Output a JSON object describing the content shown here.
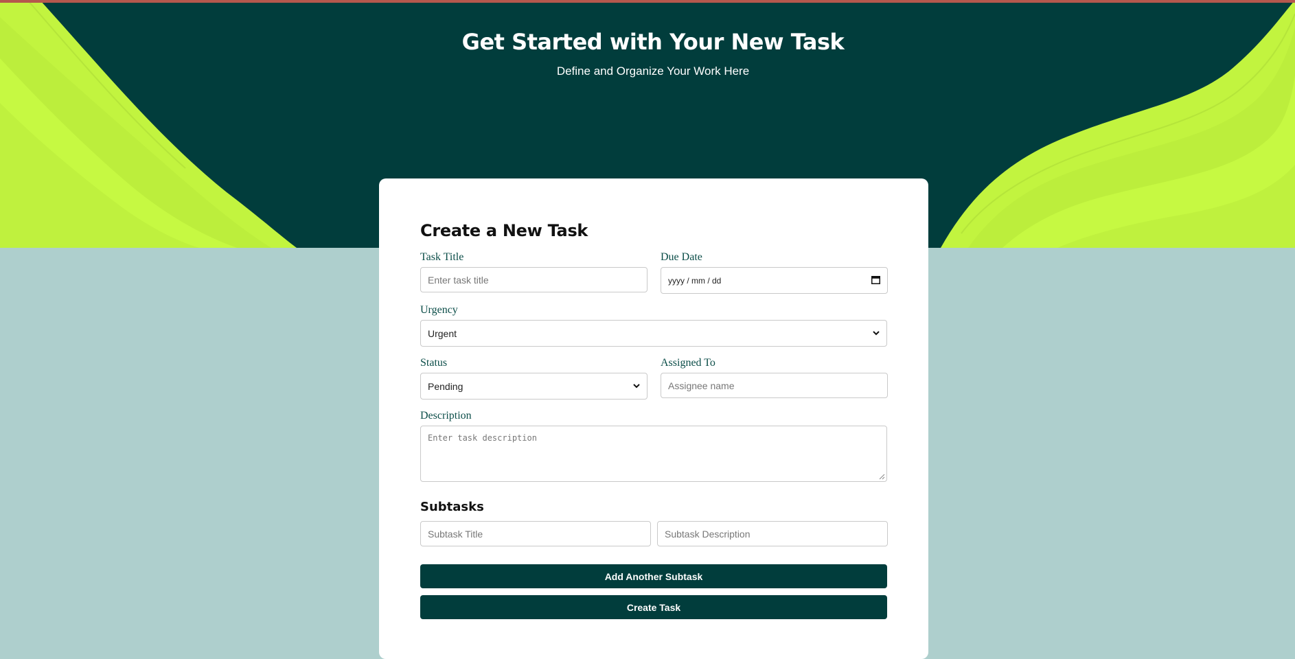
{
  "hero": {
    "title": "Get Started with Your New Task",
    "subtitle": "Define and Organize Your Work Here"
  },
  "form": {
    "title": "Create a New Task",
    "task_title": {
      "label": "Task Title",
      "placeholder": "Enter task title"
    },
    "due_date": {
      "label": "Due Date",
      "placeholder": "yyyy / mm / dd"
    },
    "urgency": {
      "label": "Urgency",
      "selected": "Urgent"
    },
    "status": {
      "label": "Status",
      "selected": "Pending"
    },
    "assigned_to": {
      "label": "Assigned To",
      "placeholder": "Assignee name"
    },
    "description": {
      "label": "Description",
      "placeholder": "Enter task description"
    },
    "subtasks": {
      "heading": "Subtasks",
      "title_placeholder": "Subtask Title",
      "description_placeholder": "Subtask Description"
    },
    "add_subtask_label": "Add Another Subtask",
    "create_label": "Create Task"
  },
  "colors": {
    "hero_bg": "#013d3c",
    "wave": "#c8fd46",
    "page_bg": "#aecfcd",
    "button": "#013d3c",
    "label": "#0b4d48"
  }
}
